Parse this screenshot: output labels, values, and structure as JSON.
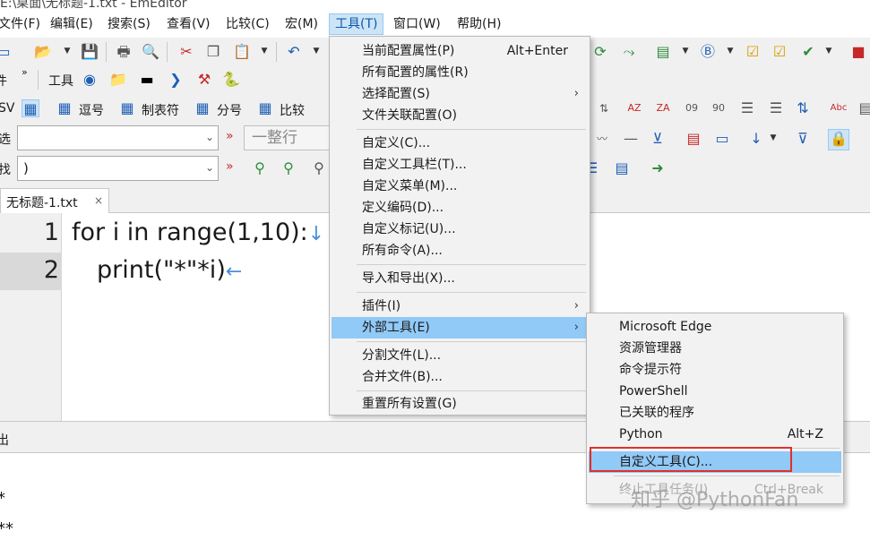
{
  "window": {
    "title": "E:\\桌面\\无标题-1.txt - EmEditor"
  },
  "menubar": [
    "文件(F)",
    "编辑(E)",
    "搜索(S)",
    "查看(V)",
    "比较(C)",
    "宏(M)",
    "工具(T)",
    "窗口(W)",
    "帮助(H)"
  ],
  "toolbar2": {
    "left_label": "件",
    "label": "工具"
  },
  "toolbar3": {
    "left_label": "SV",
    "buttons": [
      "逗号",
      "制表符",
      "分号",
      "比较"
    ]
  },
  "filter_row": {
    "label": "选",
    "value": "",
    "mode": "一整行"
  },
  "find_row": {
    "label": "找",
    "value": ")"
  },
  "tab": {
    "title": "无标题-1.txt",
    "close": "×"
  },
  "editor": {
    "lines": [
      {
        "no": "1",
        "text": "for i in range(1,10):",
        "mark": "↓"
      },
      {
        "no": "2",
        "text": "print(\"*\"*i)",
        "mark": "←"
      }
    ]
  },
  "output_panel": {
    "title": "出",
    "lines": [
      "*",
      "**"
    ]
  },
  "tools_menu": [
    {
      "label": "当前配置属性(P)",
      "shortcut": "Alt+Enter"
    },
    {
      "label": "所有配置的属性(R)"
    },
    {
      "label": "选择配置(S)",
      "submenu": "›"
    },
    {
      "label": "文件关联配置(O)"
    },
    {
      "label": "自定义(C)..."
    },
    {
      "label": "自定义工具栏(T)..."
    },
    {
      "label": "自定义菜单(M)..."
    },
    {
      "label": "定义编码(D)..."
    },
    {
      "label": "自定义标记(U)..."
    },
    {
      "label": "所有命令(A)..."
    },
    {
      "label": "导入和导出(X)..."
    },
    {
      "label": "插件(I)",
      "submenu": "›"
    },
    {
      "label": "外部工具(E)",
      "submenu": "›"
    },
    {
      "label": "分割文件(L)..."
    },
    {
      "label": "合并文件(B)..."
    },
    {
      "label": "重置所有设置(G)"
    }
  ],
  "external_tools_menu": [
    {
      "label": "Microsoft Edge"
    },
    {
      "label": "资源管理器"
    },
    {
      "label": "命令提示符"
    },
    {
      "label": "PowerShell"
    },
    {
      "label": "已关联的程序"
    },
    {
      "label": "Python",
      "shortcut": "Alt+Z"
    },
    {
      "label": "自定义工具(C)..."
    },
    {
      "label": "终止工具任务(I)",
      "shortcut": "Ctrl+Break"
    }
  ],
  "watermark": "知乎 @PythonFan",
  "colors": {
    "menu_highlight": "#91c9f7",
    "red_box": "#e0302a",
    "active_menu": "#cce4f7"
  }
}
